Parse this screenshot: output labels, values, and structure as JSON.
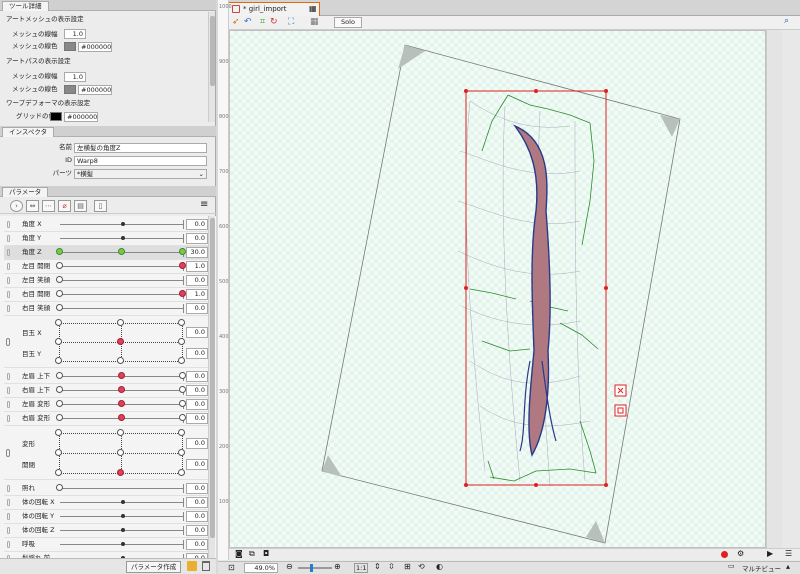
{
  "tool_detail": {
    "title": "ツール詳細",
    "art_mesh_section": "アートメッシュの表示設定",
    "art_mesh_width_label": "メッシュの線幅",
    "art_mesh_width": "1.0",
    "art_mesh_color_label": "メッシュの線色",
    "art_mesh_color": "#000000",
    "art_path_section": "アートパスの表示設定",
    "art_path_width_label": "メッシュの線幅",
    "art_path_width": "1.0",
    "art_path_color_label": "メッシュの線色",
    "art_path_color": "#000000",
    "warp_section": "ワープデフォーマの表示設定",
    "grid_color_label": "グリッドの色",
    "grid_color": "#000000"
  },
  "inspector": {
    "title": "インスペクタ",
    "name_label": "名前",
    "name_value": "左横髪の角度Z",
    "id_label": "ID",
    "id_value": "Warp8",
    "parts_label": "パーツ",
    "parts_value": "*横髪"
  },
  "parameters": {
    "title": "パラメータ",
    "rows": [
      {
        "label": "角度 X",
        "value": "0.0"
      },
      {
        "label": "角度 Y",
        "value": "0.0"
      },
      {
        "label": "角度 Z",
        "value": "30.0"
      },
      {
        "label": "左目 開閉",
        "value": "1.0"
      },
      {
        "label": "左目 笑顔",
        "value": "0.0"
      },
      {
        "label": "右目 開閉",
        "value": "1.0"
      },
      {
        "label": "右目 笑顔",
        "value": "0.0"
      }
    ],
    "eyeball": {
      "label_x": "目玉 X",
      "label_y": "目玉 Y",
      "value_x": "0.0",
      "value_y": "0.0"
    },
    "rows2": [
      {
        "label": "左眉 上下",
        "value": "0.0"
      },
      {
        "label": "右眉 上下",
        "value": "0.0"
      },
      {
        "label": "左眉 変形",
        "value": "0.0"
      },
      {
        "label": "右眉 変形",
        "value": "0.0"
      }
    ],
    "mouth": {
      "label_a": "変形",
      "label_b": "開閉",
      "value_a": "0.0",
      "value_b": "0.0"
    },
    "rows3": [
      {
        "label": "照れ",
        "value": "0.0"
      },
      {
        "label": "体の回転 X",
        "value": "0.0"
      },
      {
        "label": "体の回転 Y",
        "value": "0.0"
      },
      {
        "label": "体の回転 Z",
        "value": "0.0"
      },
      {
        "label": "呼吸",
        "value": "0.0"
      },
      {
        "label": "髪揺れ 前",
        "value": "0.0"
      }
    ],
    "create_button": "パラメータ作成"
  },
  "editor": {
    "tab_title": "* girl_import",
    "solo_label": "Solo",
    "zoom": "49.0%",
    "ratio_label": "1:1",
    "multi_view": "マルチビュー",
    "ruler_v": [
      "1000",
      "900",
      "800",
      "700",
      "600",
      "500",
      "400",
      "300",
      "200",
      "100"
    ]
  },
  "colors": {
    "accent": "#e06a10",
    "selection": "#e02020",
    "deformer": "#2a8a2a",
    "hair": "#b07880"
  }
}
